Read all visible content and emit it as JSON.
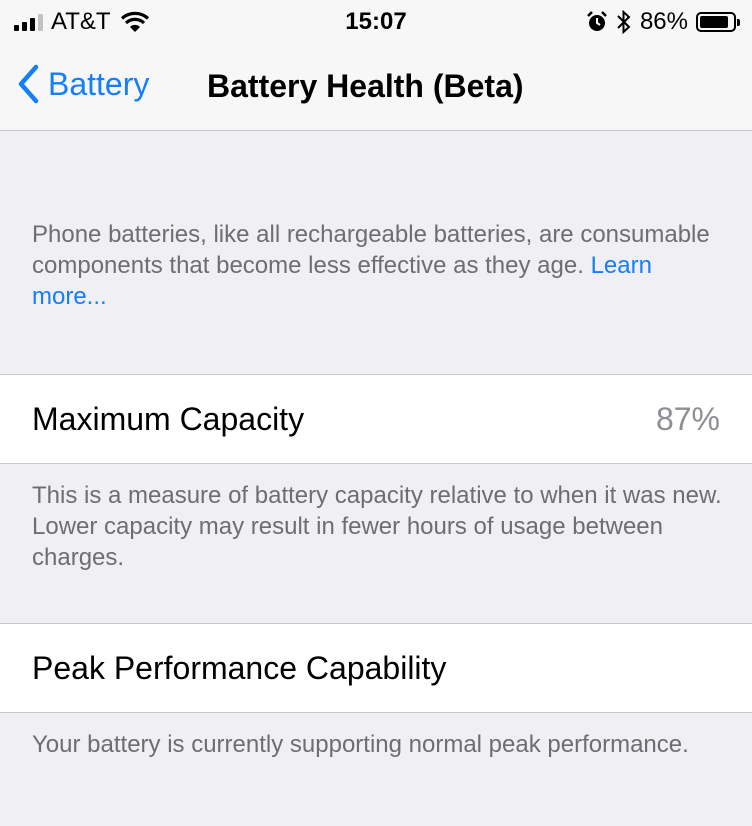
{
  "status_bar": {
    "carrier": "AT&T",
    "time": "15:07",
    "battery_percent": "86%",
    "battery_level": 0.86,
    "signal_bars_filled": 3,
    "signal_bars_total": 4,
    "icons": [
      "signal-icon",
      "wifi-icon",
      "alarm-icon",
      "bluetooth-icon",
      "battery-icon"
    ]
  },
  "nav": {
    "back_label": "Battery",
    "title": "Battery Health (Beta)",
    "accent_color": "#157efb"
  },
  "intro": {
    "text": "Phone batteries, like all rechargeable batteries, are consumable components that become less effective as they age.",
    "link": "Learn more..."
  },
  "max_capacity": {
    "label": "Maximum Capacity",
    "value": "87%",
    "description": "This is a measure of battery capacity relative to when it was new. Lower capacity may result in fewer hours of usage between charges."
  },
  "peak_performance": {
    "label": "Peak Performance Capability",
    "description": "Your battery is currently supporting normal peak performance."
  }
}
